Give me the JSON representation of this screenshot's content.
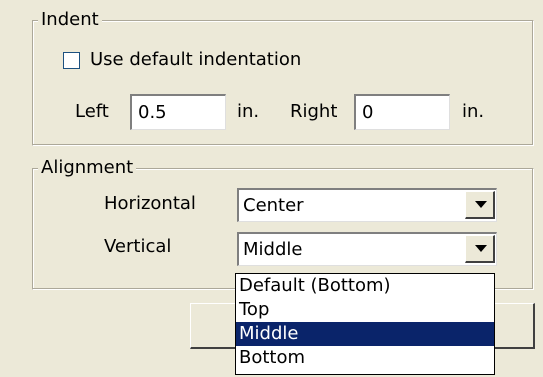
{
  "indent": {
    "group_label": "Indent",
    "use_default_label": "Use default indentation",
    "use_default_checked": false,
    "left_label": "Left",
    "left_value": "0.5",
    "left_unit": "in.",
    "right_label": "Right",
    "right_value": "0",
    "right_unit": "in."
  },
  "alignment": {
    "group_label": "Alignment",
    "horizontal_label": "Horizontal",
    "horizontal_value": "Center",
    "vertical_label": "Vertical",
    "vertical_value": "Middle"
  },
  "vertical_dropdown": {
    "options": [
      "Default (Bottom)",
      "Top",
      "Middle",
      "Bottom"
    ],
    "selected": "Middle"
  }
}
